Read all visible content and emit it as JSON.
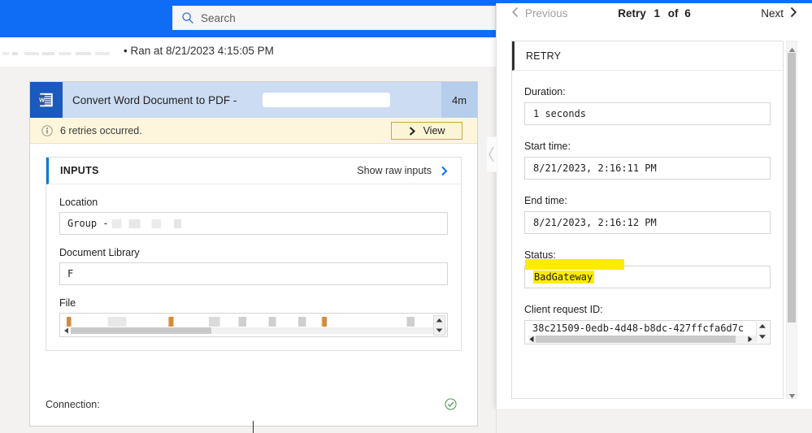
{
  "topbar": {
    "search": {
      "placeholder": "Search",
      "value": "",
      "icon": "search-icon"
    },
    "accent_color": "#0f6cf5"
  },
  "breadcrumb": {
    "run_text": "• Ran at 8/21/2023 4:15:05 PM",
    "flow_name_redacted": ""
  },
  "canvas": {
    "card": {
      "app_icon": "word-icon",
      "title": "Convert Word Document to PDF -",
      "title_suffix_redacted": "",
      "duration": "4m",
      "status_badge_icon": "clock-icon",
      "status_badge_color": "#f7941e",
      "warning": {
        "icon": "info-icon",
        "text": "6 retries occurred.",
        "button_label": "View",
        "button_icon": "chevron-right-icon"
      },
      "inputs": {
        "section_label": "INPUTS",
        "show_raw_label": "Show raw inputs",
        "show_raw_icon": "chevron-right-icon",
        "fields": [
          {
            "label": "Location",
            "value": "Group  -",
            "redacted": true
          },
          {
            "label": "Document Library",
            "value": "F",
            "redacted": false
          },
          {
            "label": "File",
            "value": "",
            "redacted": true
          }
        ]
      },
      "connection": {
        "label": "Connection:",
        "status_icon": "check-circle-icon",
        "status_color": "#3a8a3a"
      }
    }
  },
  "retry_panel": {
    "nav": {
      "previous_label": "Previous",
      "previous_icon": "chevron-left-icon",
      "next_label": "Next",
      "next_icon": "chevron-right-icon",
      "title_prefix": "Retry",
      "current": "1",
      "separator": "of",
      "total": "6"
    },
    "section_label": "RETRY",
    "fields": [
      {
        "label": "Duration:",
        "value": "1 seconds"
      },
      {
        "label": "Start time:",
        "value": "8/21/2023, 2:16:11 PM"
      },
      {
        "label": "End time:",
        "value": "8/21/2023, 2:16:12 PM"
      },
      {
        "label": "Status:",
        "value": "BadGateway",
        "highlight": "#ffeb00"
      },
      {
        "label": "Client request ID:",
        "value": "38c21509-0edb-4d48-b8dc-427ffcfa6d7c"
      }
    ]
  }
}
